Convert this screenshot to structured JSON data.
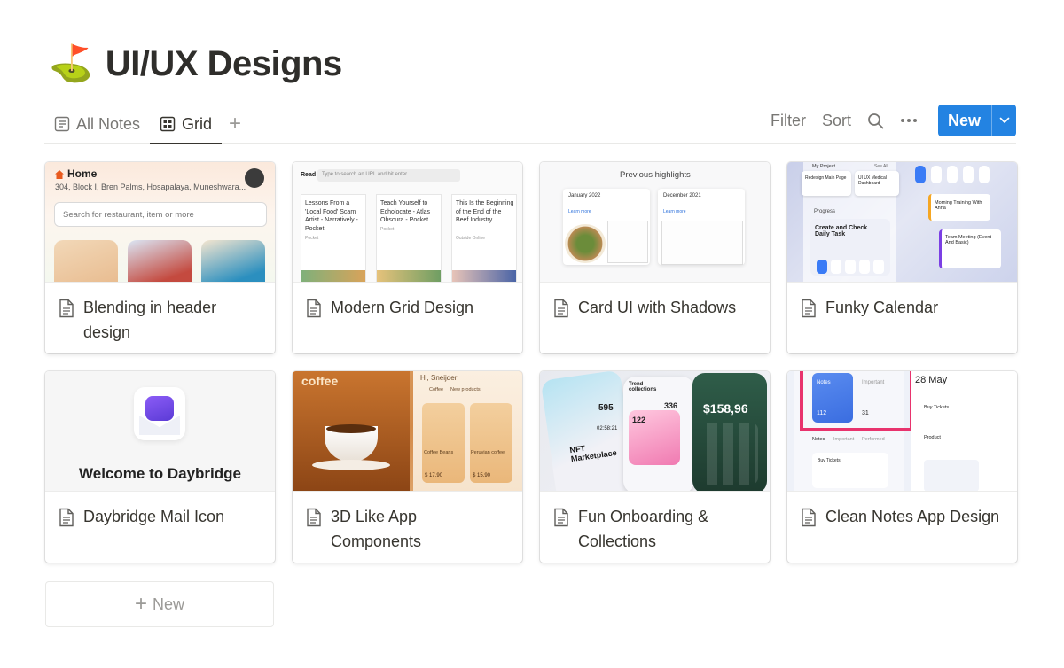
{
  "page": {
    "emoji": "⛳",
    "title": "UI/UX Designs"
  },
  "views": [
    {
      "label": "All Notes",
      "icon": "document-list-icon",
      "active": false
    },
    {
      "label": "Grid",
      "icon": "grid-icon",
      "active": true
    }
  ],
  "toolbar": {
    "filter": "Filter",
    "sort": "Sort",
    "new": "New"
  },
  "cards": [
    {
      "title": "Blending in header design",
      "cover": {
        "home": "Home",
        "address": "304, Block I, Bren Palms, Hosapalaya, Muneshwara...",
        "search": "Search for restaurant, item or more"
      }
    },
    {
      "title": "Modern Grid Design",
      "cover": {
        "read": "Read",
        "input": "Type to search an URL and hit enter",
        "items": [
          {
            "title": "Lessons From a 'Local Food' Scam Artist - Narratively - Pocket",
            "source": "Pocket"
          },
          {
            "title": "Teach Yourself to Echolocate - Atlas Obscura - Pocket",
            "source": "Pocket"
          },
          {
            "title": "This Is the Beginning of the End of the Beef Industry",
            "source": "Outside Online"
          }
        ]
      }
    },
    {
      "title": "Card UI with Shadows",
      "cover": {
        "heading": "Previous highlights",
        "left": "January 2022",
        "right": "December 2021",
        "link": "Learn more"
      }
    },
    {
      "title": "Funky Calendar",
      "cover": {
        "project": "My Project",
        "see_all": "See All",
        "task1": "Redesign Main Page",
        "task2": "UI UX Medical Dashboard",
        "progress": "Progress",
        "create": "Create and Check Daily Task",
        "meeting1": "Morning Training With Anna",
        "meeting2": "Team Meeting (Event And Basic)"
      }
    },
    {
      "title": "Daybridge Mail Icon",
      "cover": {
        "welcome": "Welcome to Daybridge"
      }
    },
    {
      "title": "3D Like App Components",
      "cover": {
        "heading": "coffee",
        "greeting": "Hi, Sneijder",
        "chip1": "Coffee",
        "chip2": "New products",
        "item1": "Coffee Beans",
        "item2": "Peruvian coffee",
        "price1": "$ 17.90",
        "price2": "$ 15.90"
      }
    },
    {
      "title": "Fun Onboarding & Collections",
      "cover": {
        "nft": "NFT Marketplace",
        "amount": "$158,96",
        "num1": "595",
        "num2": "122",
        "num3": "336",
        "trend": "Trend collections",
        "timer": "02:58:21"
      }
    },
    {
      "title": "Clean Notes App Design",
      "cover": {
        "notes": "Notes",
        "important": "Important",
        "notes_count": "112",
        "important_count": "31",
        "date": "28 May",
        "buy": "Buy Tickets",
        "product": "Product",
        "tab1": "Notes",
        "tab2": "Important",
        "tab3": "Performed"
      }
    }
  ],
  "add_card": {
    "label": "New"
  },
  "colors": {
    "accent": "#2383e2",
    "text": "#37352f",
    "muted": "#787774"
  }
}
